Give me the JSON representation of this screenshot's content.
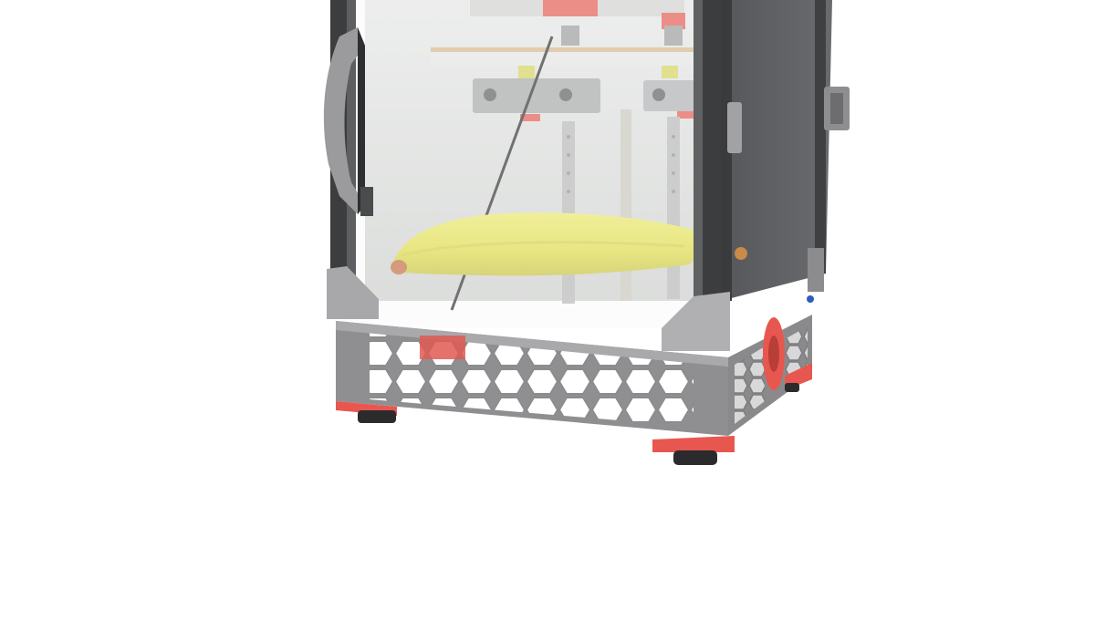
{
  "scene": {
    "subject": "enclosed-3d-printer-render",
    "colors": {
      "background": "#ffffff",
      "frame": "#4a4a4c",
      "frame_dark": "#2f3032",
      "plastic_grey": "#9a9a9c",
      "plastic_light": "#b4b4b6",
      "accent_red": "#e8574f",
      "banana": "#e6e24a",
      "banana_shade": "#c9c43a",
      "bed": "#e9e9e6",
      "glass_tint": "#f2f3f2"
    },
    "icons": {
      "door_handle": "door-handle-icon",
      "hex_grille": "hex-grille-icon",
      "foot": "foot-icon"
    }
  }
}
